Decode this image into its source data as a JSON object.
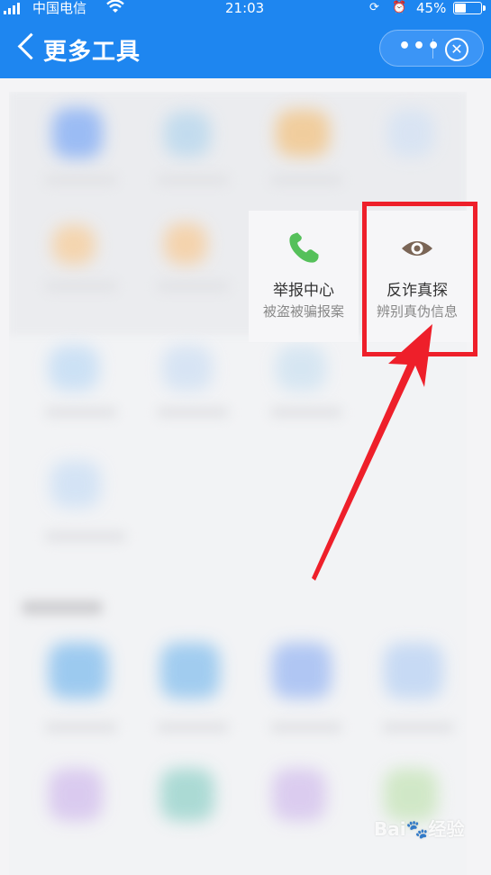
{
  "status_bar": {
    "carrier": "中国电信",
    "time": "21:03",
    "battery": "45%",
    "wifi_icon": "wifi-icon",
    "lock_icon": "rotation-lock-icon",
    "alarm_icon": "alarm-icon"
  },
  "nav": {
    "title": "更多工具",
    "back_icon": "chevron-left-icon",
    "more_label": "•••",
    "close_icon": "close-circle-icon",
    "close_glyph": "✕"
  },
  "tools": [
    {
      "name": "举报中心",
      "desc": "被盗被骗报案",
      "icon": "phone-icon",
      "color": "#55c05a"
    },
    {
      "name": "反诈真探",
      "desc": "辨别真伪信息",
      "icon": "eye-icon",
      "color": "#7a6556"
    }
  ],
  "annotation": {
    "highlight_color": "#ee1f2a"
  },
  "watermark": "Bai🐾经验"
}
